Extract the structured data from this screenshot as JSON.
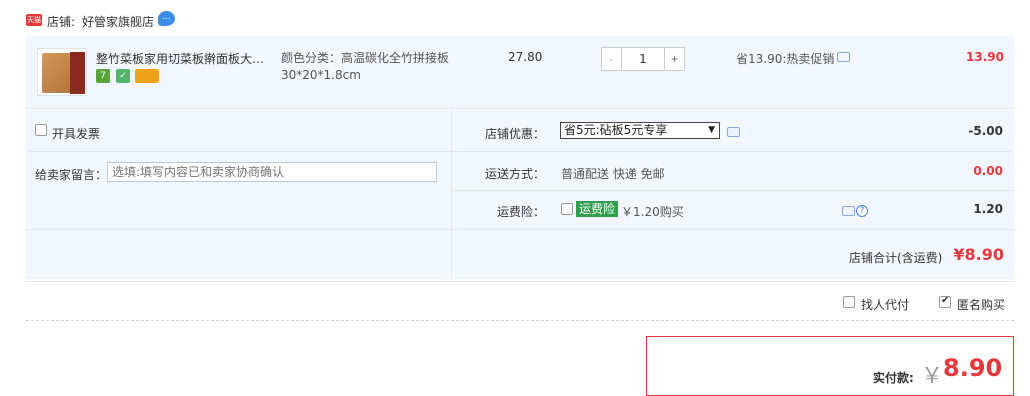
{
  "shop": {
    "badge": "天猫",
    "prefix": "店铺:",
    "name": "好管家旗舰店"
  },
  "item": {
    "title": "整竹菜板家用切菜板擀面板大号...",
    "sku": "颜色分类：高温碳化全竹拼接板30*20*1.8cm",
    "unit_price": "27.80",
    "quantity": "1",
    "qty_minus": "-",
    "qty_plus": "+",
    "promo": "省13.90:热卖促销",
    "total": "13.90",
    "badges": [
      "7",
      "✓",
      ""
    ]
  },
  "options": {
    "invoice_label": "开具发票",
    "message_label": "给卖家留言：",
    "message_placeholder": "选填:填写内容已和卖家协商确认",
    "shop_discount_label": "店铺优惠：",
    "shop_discount_selected": "省5元:砧板5元专享",
    "shop_discount_amount": "-5.00",
    "shipping_label": "运送方式：",
    "shipping_value": "普通配送 快递 免邮",
    "shipping_amount": "0.00",
    "insurance_label": "运费险：",
    "insurance_badge": "运费险",
    "insurance_text": "￥1.20购买",
    "insurance_amount": "1.20",
    "help_glyph": "?"
  },
  "shop_total": {
    "label": "店铺合计(含运费)",
    "amount": "¥8.90"
  },
  "footer": {
    "pay_for_label": "找人代付",
    "anonymous_label": "匿名购买",
    "anonymous_checked": true
  },
  "payment": {
    "label": "实付款:",
    "currency": "￥",
    "amount": "8.90"
  },
  "colors": {
    "accent_red": "#e4393c",
    "row_bg": "#f2f7ff",
    "insurance_green": "#2f9e4f",
    "link_blue": "#3d8ee9"
  }
}
